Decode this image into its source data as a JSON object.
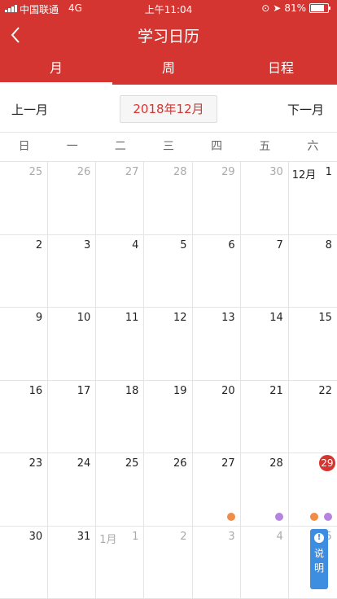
{
  "status": {
    "carrier": "中国联通",
    "network": "4G",
    "time": "上午11:04",
    "battery": "81%"
  },
  "header": {
    "title": "学习日历"
  },
  "tabs": [
    {
      "label": "月",
      "active": true
    },
    {
      "label": "周",
      "active": false
    },
    {
      "label": "日程",
      "active": false
    }
  ],
  "nav": {
    "prev": "上一月",
    "current": "2018年12月",
    "next": "下一月"
  },
  "weekdays": [
    "日",
    "一",
    "二",
    "三",
    "四",
    "五",
    "六"
  ],
  "days": [
    {
      "num": "25",
      "other": true
    },
    {
      "num": "26",
      "other": true
    },
    {
      "num": "27",
      "other": true
    },
    {
      "num": "28",
      "other": true
    },
    {
      "num": "29",
      "other": true
    },
    {
      "num": "30",
      "other": true
    },
    {
      "num": "1",
      "month_label": "12月"
    },
    {
      "num": "2"
    },
    {
      "num": "3"
    },
    {
      "num": "4"
    },
    {
      "num": "5"
    },
    {
      "num": "6"
    },
    {
      "num": "7"
    },
    {
      "num": "8"
    },
    {
      "num": "9"
    },
    {
      "num": "10"
    },
    {
      "num": "11"
    },
    {
      "num": "12"
    },
    {
      "num": "13"
    },
    {
      "num": "14"
    },
    {
      "num": "15"
    },
    {
      "num": "16"
    },
    {
      "num": "17"
    },
    {
      "num": "18"
    },
    {
      "num": "19"
    },
    {
      "num": "20"
    },
    {
      "num": "21"
    },
    {
      "num": "22"
    },
    {
      "num": "23"
    },
    {
      "num": "24"
    },
    {
      "num": "25"
    },
    {
      "num": "26"
    },
    {
      "num": "27",
      "dots": [
        "#f08c46"
      ]
    },
    {
      "num": "28",
      "dots": [
        "#b583e0"
      ]
    },
    {
      "num": "29",
      "today": true,
      "dots": [
        "#f08c46",
        "#b583e0"
      ]
    },
    {
      "num": "30"
    },
    {
      "num": "31"
    },
    {
      "num": "1",
      "month_label": "1月",
      "other": true
    },
    {
      "num": "2",
      "other": true
    },
    {
      "num": "3",
      "other": true
    },
    {
      "num": "4",
      "other": true
    },
    {
      "num": "5",
      "other": true
    }
  ],
  "help_button": {
    "icon_glyph": "!",
    "label": "说明"
  },
  "colors": {
    "primary": "#d43530",
    "event_orange": "#f08c46",
    "event_purple": "#b583e0",
    "help_blue": "#3d8ee0"
  }
}
